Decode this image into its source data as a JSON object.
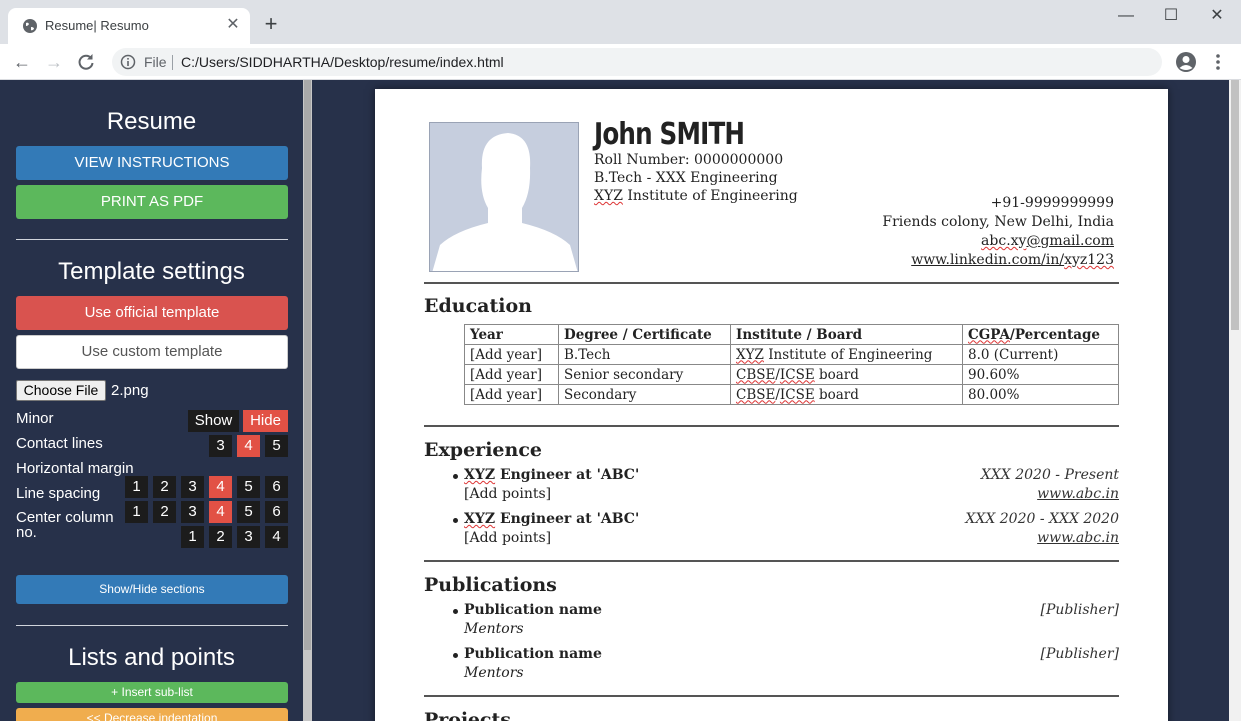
{
  "browser": {
    "tab_title": "Resume| Resumo",
    "url_scheme": "File",
    "url": "C:/Users/SIDDHARTHA/Desktop/resume/index.html"
  },
  "sidebar": {
    "resume_heading": "Resume",
    "view_instructions": "VIEW INSTRUCTIONS",
    "print_pdf": "PRINT AS PDF",
    "template_heading": "Template settings",
    "official_template": "Use official template",
    "custom_template": "Use custom template",
    "choose_file": "Choose File",
    "file_name": "2.png",
    "minor_label": "Minor",
    "show_label": "Show",
    "hide_label": "Hide",
    "contact_lines_label": "Contact lines",
    "contact_lines_options": [
      "3",
      "4",
      "5"
    ],
    "contact_lines_selected": "4",
    "horizontal_margin_label": "Horizontal margin",
    "line_spacing_label": "Line spacing",
    "horizontal_margin_options": [
      "1",
      "2",
      "3",
      "4",
      "5",
      "6"
    ],
    "line_spacing_options": [
      "1",
      "2",
      "3",
      "4",
      "5",
      "6"
    ],
    "center_column_label": "Center column no.",
    "center_column_options": [
      "1",
      "2",
      "3",
      "4"
    ],
    "show_hide_sections": "Show/Hide sections",
    "lists_heading": "Lists and points",
    "insert_sublist": "+ Insert sub-list",
    "decrease_indentation": "<< Decrease indentation",
    "colors": {
      "blue": "#337ab7",
      "green": "#5cb85c",
      "red": "#d9534f",
      "orange": "#f0ad4e",
      "active": "#e25145"
    }
  },
  "resume": {
    "first_name": "John",
    "last_name": "SMITH",
    "roll_number": "Roll Number: 0000000000",
    "degree": "B.Tech - XXX Engineering",
    "institute_prefix": "XYZ",
    "institute_rest": " Institute of Engineering",
    "phone": "+91-9999999999",
    "address": "Friends colony, New Delhi, India",
    "email_user": "abc.xy",
    "email_domain": "@gmail.com",
    "linkedin": {
      "a": "www.linkedin.com",
      "b": "/in/",
      "c": "xyz123"
    },
    "education": {
      "title": "Education",
      "headers": [
        "Year",
        "Degree / Certificate",
        "Institute / Board",
        "CGPA/Percentage"
      ],
      "rows": [
        [
          "[Add year]",
          "B.Tech",
          "XYZ Institute of Engineering",
          "8.0 (Current)"
        ],
        [
          "[Add year]",
          "Senior secondary",
          "CBSE/ICSE board",
          "90.60%"
        ],
        [
          "[Add year]",
          "Secondary",
          "CBSE/ICSE board",
          "80.00%"
        ]
      ]
    },
    "experience": {
      "title": "Experience",
      "items": [
        {
          "title_a": "XYZ",
          "title_b": " Engineer at 'ABC'",
          "sub": "[Add points]",
          "date": "XXX 2020 - Present",
          "link": "www.abc.in"
        },
        {
          "title_a": "XYZ",
          "title_b": " Engineer at 'ABC'",
          "sub": "[Add points]",
          "date": "XXX 2020 - XXX 2020",
          "link": "www.abc.in"
        }
      ]
    },
    "publications": {
      "title": "Publications",
      "items": [
        {
          "name": "Publication name",
          "sub": "Mentors",
          "publisher": "[Publisher]"
        },
        {
          "name": "Publication name",
          "sub": "Mentors",
          "publisher": "[Publisher]"
        }
      ]
    },
    "projects_title": "Projects"
  }
}
